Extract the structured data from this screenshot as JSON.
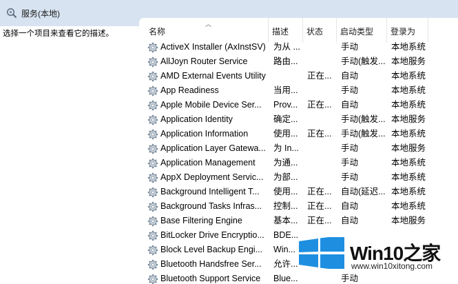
{
  "window": {
    "title": "服务(本地)",
    "icon": "magnifier-gear-icon"
  },
  "description_pane": {
    "text": "选择一个项目来查看它的描述。"
  },
  "columns": [
    "名称",
    "描述",
    "状态",
    "启动类型",
    "登录为"
  ],
  "services": [
    {
      "name": "ActiveX Installer (AxInstSV)",
      "desc": "为从 ...",
      "status": "",
      "startup": "手动",
      "logon": "本地系统"
    },
    {
      "name": "AllJoyn Router Service",
      "desc": "路由...",
      "status": "",
      "startup": "手动(触发...",
      "logon": "本地服务"
    },
    {
      "name": "AMD External Events Utility",
      "desc": "",
      "status": "正在...",
      "startup": "自动",
      "logon": "本地系统"
    },
    {
      "name": "App Readiness",
      "desc": "当用...",
      "status": "",
      "startup": "手动",
      "logon": "本地系统"
    },
    {
      "name": "Apple Mobile Device Ser...",
      "desc": "Prov...",
      "status": "正在...",
      "startup": "自动",
      "logon": "本地系统"
    },
    {
      "name": "Application Identity",
      "desc": "确定...",
      "status": "",
      "startup": "手动(触发...",
      "logon": "本地服务"
    },
    {
      "name": "Application Information",
      "desc": "使用...",
      "status": "正在...",
      "startup": "手动(触发...",
      "logon": "本地系统"
    },
    {
      "name": "Application Layer Gatewa...",
      "desc": "为 In...",
      "status": "",
      "startup": "手动",
      "logon": "本地服务"
    },
    {
      "name": "Application Management",
      "desc": "为通...",
      "status": "",
      "startup": "手动",
      "logon": "本地系统"
    },
    {
      "name": "AppX Deployment Servic...",
      "desc": "为部...",
      "status": "",
      "startup": "手动",
      "logon": "本地系统"
    },
    {
      "name": "Background Intelligent T...",
      "desc": "使用...",
      "status": "正在...",
      "startup": "自动(延迟...",
      "logon": "本地系统"
    },
    {
      "name": "Background Tasks Infras...",
      "desc": "控制...",
      "status": "正在...",
      "startup": "自动",
      "logon": "本地系统"
    },
    {
      "name": "Base Filtering Engine",
      "desc": "基本...",
      "status": "正在...",
      "startup": "自动",
      "logon": "本地服务"
    },
    {
      "name": "BitLocker Drive Encryptio...",
      "desc": "BDE...",
      "status": "",
      "startup": "",
      "logon": ""
    },
    {
      "name": "Block Level Backup Engi...",
      "desc": "Win...",
      "status": "",
      "startup": "",
      "logon": ""
    },
    {
      "name": "Bluetooth Handsfree Ser...",
      "desc": "允许...",
      "status": "",
      "startup": "",
      "logon": ""
    },
    {
      "name": "Bluetooth Support Service",
      "desc": "Blue...",
      "status": "",
      "startup": "手动",
      "logon": ""
    }
  ],
  "watermark": {
    "brand": "Win10之家",
    "url": "www.win10xitong.com",
    "colors": {
      "logo": "#1e8fe0",
      "brand_accent": "#e02424"
    }
  },
  "colors": {
    "header_bg": "#d7e3f0",
    "pane_bg": "#ffffff",
    "text": "#000000"
  }
}
